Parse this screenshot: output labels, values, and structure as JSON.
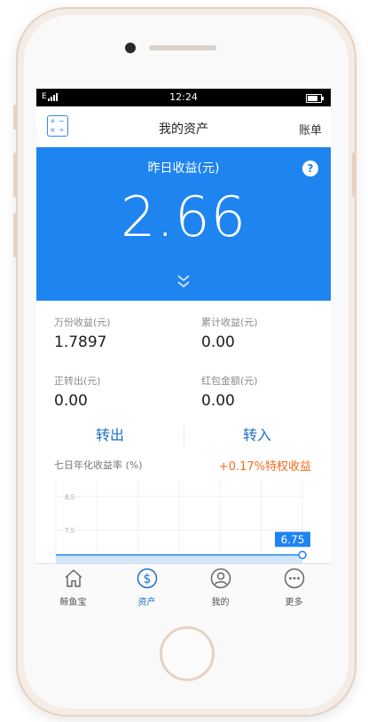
{
  "statusbar": {
    "carrier": "E",
    "time": "12:24"
  },
  "navbar": {
    "title": "我的资产",
    "bill": "账单",
    "calc_icon": "calculator-icon"
  },
  "hero": {
    "label": "昨日收益(元)",
    "value": "2.66",
    "help": "?",
    "expand_icon": "double-chevron-down-icon",
    "color": "#1e84f0"
  },
  "stats": [
    {
      "label": "万份收益(元)",
      "value": "1.7897"
    },
    {
      "label": "累计收益(元)",
      "value": "0.00"
    },
    {
      "label": "正转出(元)",
      "value": "0.00"
    },
    {
      "label": "红包金额(元)",
      "value": "0.00"
    }
  ],
  "actions": {
    "transfer_out": "转出",
    "transfer_in": "转入"
  },
  "yield_chart": {
    "title": "七日年化收益率 (%)",
    "promo": "+0.17%特权收益",
    "promo_color": "#f76b1c"
  },
  "chart_data": {
    "type": "area",
    "ytick_labels": [
      "8.5",
      "7.5"
    ],
    "ylim": [
      6.5,
      9.0
    ],
    "series": [
      {
        "values": [
          6.75,
          6.75,
          6.75,
          6.75,
          6.75,
          6.75,
          6.75
        ]
      }
    ],
    "data_label": "6.75",
    "grid": true
  },
  "tabs": [
    {
      "label": "鲸鱼宝",
      "icon": "home-icon"
    },
    {
      "label": "资产",
      "icon": "dollar-circle-icon"
    },
    {
      "label": "我的",
      "icon": "user-icon"
    },
    {
      "label": "更多",
      "icon": "more-icon"
    }
  ],
  "active_tab": 1,
  "time_indicator": "12:24"
}
